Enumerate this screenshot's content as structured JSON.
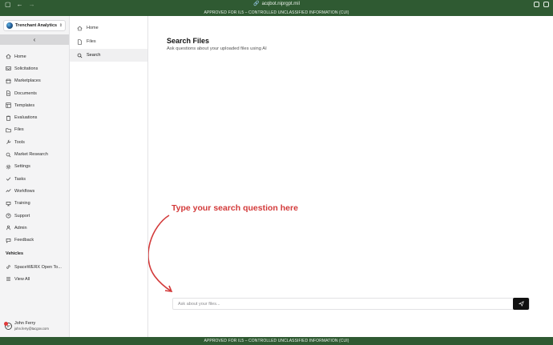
{
  "browser": {
    "url": "acqbot.niprgpt.mil"
  },
  "banner": {
    "top": "APPROVED FOR IL5 – CONTROLLED UNCLASSIFIED INFORMATION (CUI)",
    "bottom": "APPROVED FOR IL5 – CONTROLLED UNCLASSIFIED INFORMATION (CUI)"
  },
  "sidebar": {
    "org_name": "Trenchant Analytics",
    "collapse_glyph": "‹",
    "items": [
      {
        "label": "Home",
        "icon": "home-icon"
      },
      {
        "label": "Solicitations",
        "icon": "inbox-icon"
      },
      {
        "label": "Marketplaces",
        "icon": "store-icon"
      },
      {
        "label": "Documents",
        "icon": "document-icon"
      },
      {
        "label": "Templates",
        "icon": "template-icon"
      },
      {
        "label": "Evaluations",
        "icon": "clipboard-icon"
      },
      {
        "label": "Files",
        "icon": "folder-icon"
      },
      {
        "label": "Tools",
        "icon": "tools-icon"
      },
      {
        "label": "Market Research",
        "icon": "search-icon"
      },
      {
        "label": "Settings",
        "icon": "gear-icon"
      },
      {
        "label": "Tasks",
        "icon": "check-icon"
      },
      {
        "label": "Workflows",
        "icon": "workflow-icon"
      },
      {
        "label": "Training",
        "icon": "training-icon"
      },
      {
        "label": "Support",
        "icon": "support-icon"
      },
      {
        "label": "Admin",
        "icon": "admin-icon"
      },
      {
        "label": "Feedback",
        "icon": "feedback-icon"
      }
    ],
    "vehicles_title": "Vehicles",
    "vehicles": [
      {
        "label": "SpaceWERX Open To...",
        "icon": "link-icon"
      },
      {
        "label": "View All",
        "icon": "list-icon"
      }
    ],
    "user": {
      "name": "John Ferry",
      "email": "john.ferry@tacgov.com"
    }
  },
  "subnav": {
    "items": [
      {
        "label": "Home",
        "icon": "home-icon",
        "active": false
      },
      {
        "label": "Files",
        "icon": "file-icon",
        "active": false
      },
      {
        "label": "Search",
        "icon": "search-icon",
        "active": true
      }
    ]
  },
  "main": {
    "title": "Search Files",
    "subtitle": "Ask questions about your uploaded files using AI",
    "annotation": "Type your search question here",
    "search_placeholder": "Ask about your files..."
  },
  "colors": {
    "banner_green": "#2f5a32",
    "annotation_red": "#d33a3a",
    "send_button": "#111111"
  }
}
